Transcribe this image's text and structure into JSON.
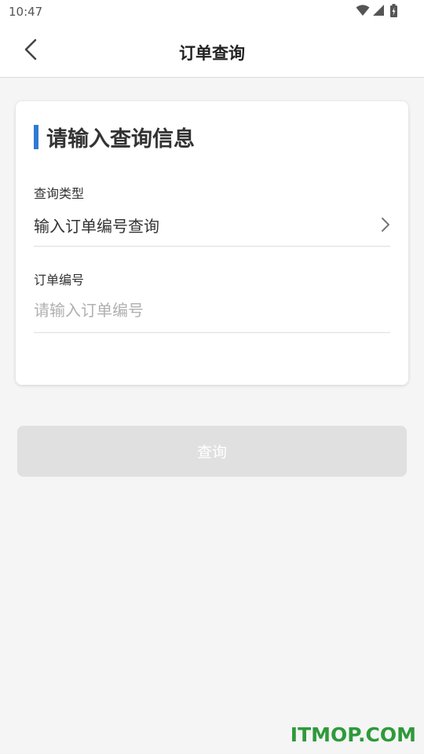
{
  "status_bar": {
    "time": "10:47",
    "icons": [
      "wifi-icon",
      "signal-icon",
      "battery-icon"
    ]
  },
  "header": {
    "title": "订单查询",
    "back_icon": "chevron-left-icon"
  },
  "form": {
    "section_title": "请输入查询信息",
    "query_type": {
      "label": "查询类型",
      "value": "输入订单编号查询",
      "icon": "chevron-right-icon"
    },
    "order_number": {
      "label": "订单编号",
      "placeholder": "请输入订单编号",
      "value": ""
    }
  },
  "actions": {
    "query_label": "查询"
  },
  "watermark": "ITMOP.COM",
  "colors": {
    "accent": "#2f7ad6",
    "background": "#f5f5f5",
    "button_disabled": "#e0e0e0",
    "watermark": "#2e9a3a"
  }
}
